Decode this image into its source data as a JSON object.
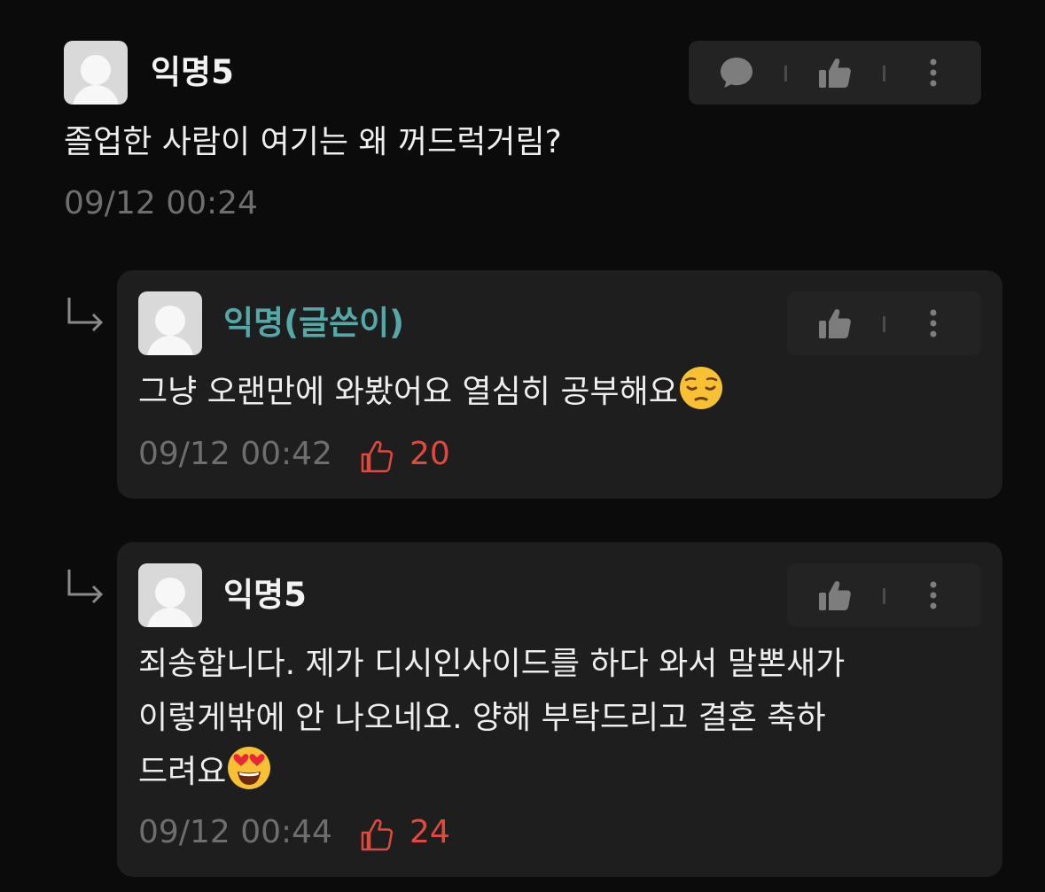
{
  "colors": {
    "background": "#0b0b0b",
    "card": "#1e1e1e",
    "action_bar": "#232323",
    "author_op": "#55a8a8",
    "like": "#e04a3e",
    "meta": "#6e6e6e"
  },
  "comment": {
    "author": "익명5",
    "text": "졸업한 사람이 여기는 왜 꺼드럭거림?",
    "time": "09/12 00:24",
    "actions": [
      "speech-bubble-icon",
      "thumbs-up-icon",
      "more-vertical-icon"
    ]
  },
  "replies": [
    {
      "author": "익명(글쓴이)",
      "is_op": true,
      "lines": [
        "그냥 오랜만에 와봤어요 열심히 공부해요"
      ],
      "emoji": "pensive-face",
      "time": "09/12 00:42",
      "likes": "20",
      "actions": [
        "thumbs-up-icon",
        "more-vertical-icon"
      ]
    },
    {
      "author": "익명5",
      "is_op": false,
      "lines": [
        "죄송합니다. 제가 디시인사이드를 하다 와서 말뽄새가",
        "이렇게밖에 안 나오네요. 양해 부탁드리고 결혼 축하",
        "드려요"
      ],
      "emoji": "heart-eyes-face",
      "time": "09/12 00:44",
      "likes": "24",
      "actions": [
        "thumbs-up-icon",
        "more-vertical-icon"
      ]
    }
  ]
}
